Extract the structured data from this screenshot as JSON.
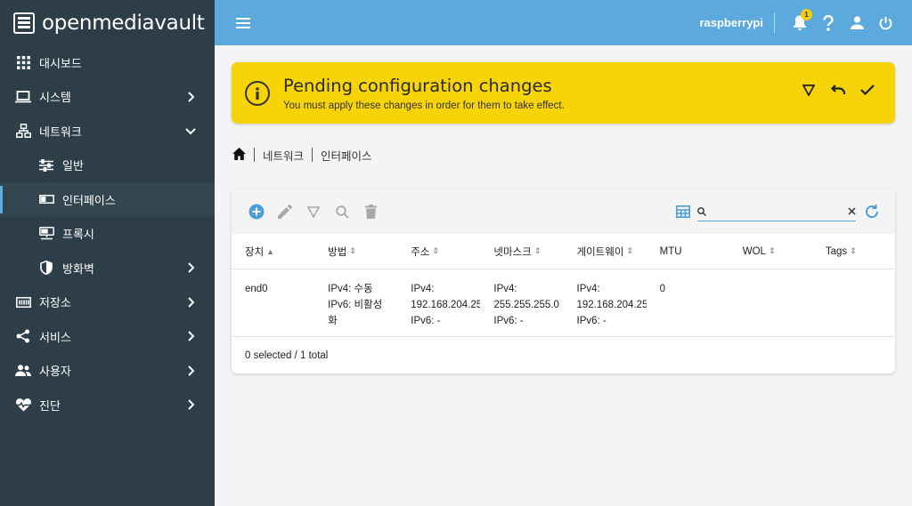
{
  "app": {
    "logo_text": "openmediavault",
    "hostname": "raspberrypi",
    "notification_count": "1"
  },
  "sidebar": {
    "items": [
      {
        "label": "대시보드",
        "icon": "dashboard-icon"
      },
      {
        "label": "시스템",
        "icon": "laptop-icon"
      },
      {
        "label": "네트워크",
        "icon": "network-icon"
      },
      {
        "label": "일반",
        "icon": "sliders-icon"
      },
      {
        "label": "인터페이스",
        "icon": "ethernet-icon"
      },
      {
        "label": "프록시",
        "icon": "proxy-icon"
      },
      {
        "label": "방화벽",
        "icon": "shield-icon"
      },
      {
        "label": "저장소",
        "icon": "storage-icon"
      },
      {
        "label": "서비스",
        "icon": "share-icon"
      },
      {
        "label": "사용자",
        "icon": "users-icon"
      },
      {
        "label": "진단",
        "icon": "heartbeat-icon"
      }
    ]
  },
  "banner": {
    "title": "Pending configuration changes",
    "subtitle": "You must apply these changes in order for them to take effect."
  },
  "breadcrumb": {
    "level1": "네트워크",
    "level2": "인터페이스"
  },
  "search": {
    "value": ""
  },
  "table": {
    "columns": [
      "장치",
      "방법",
      "주소",
      "넷마스크",
      "게이트웨이",
      "MTU",
      "WOL",
      "Tags"
    ],
    "rows": [
      {
        "device": "end0",
        "method": [
          "IPv4: 수동",
          "IPv6: 비활성",
          "화"
        ],
        "address": [
          "IPv4:",
          "192.168.204.25",
          "IPv6: -"
        ],
        "netmask": [
          "IPv4:",
          "255.255.255.0",
          "IPv6: -"
        ],
        "gateway": [
          "IPv4:",
          "192.168.204.25",
          "IPv6: -"
        ],
        "mtu": "0",
        "wol": "",
        "tags": ""
      }
    ],
    "footer": "0 selected / 1 total"
  },
  "colors": {
    "sidebar_bg": "#2d3e48",
    "topbar_bg": "#5ba9dd",
    "banner_bg": "#f7d408",
    "accent": "#5ba9dd"
  }
}
